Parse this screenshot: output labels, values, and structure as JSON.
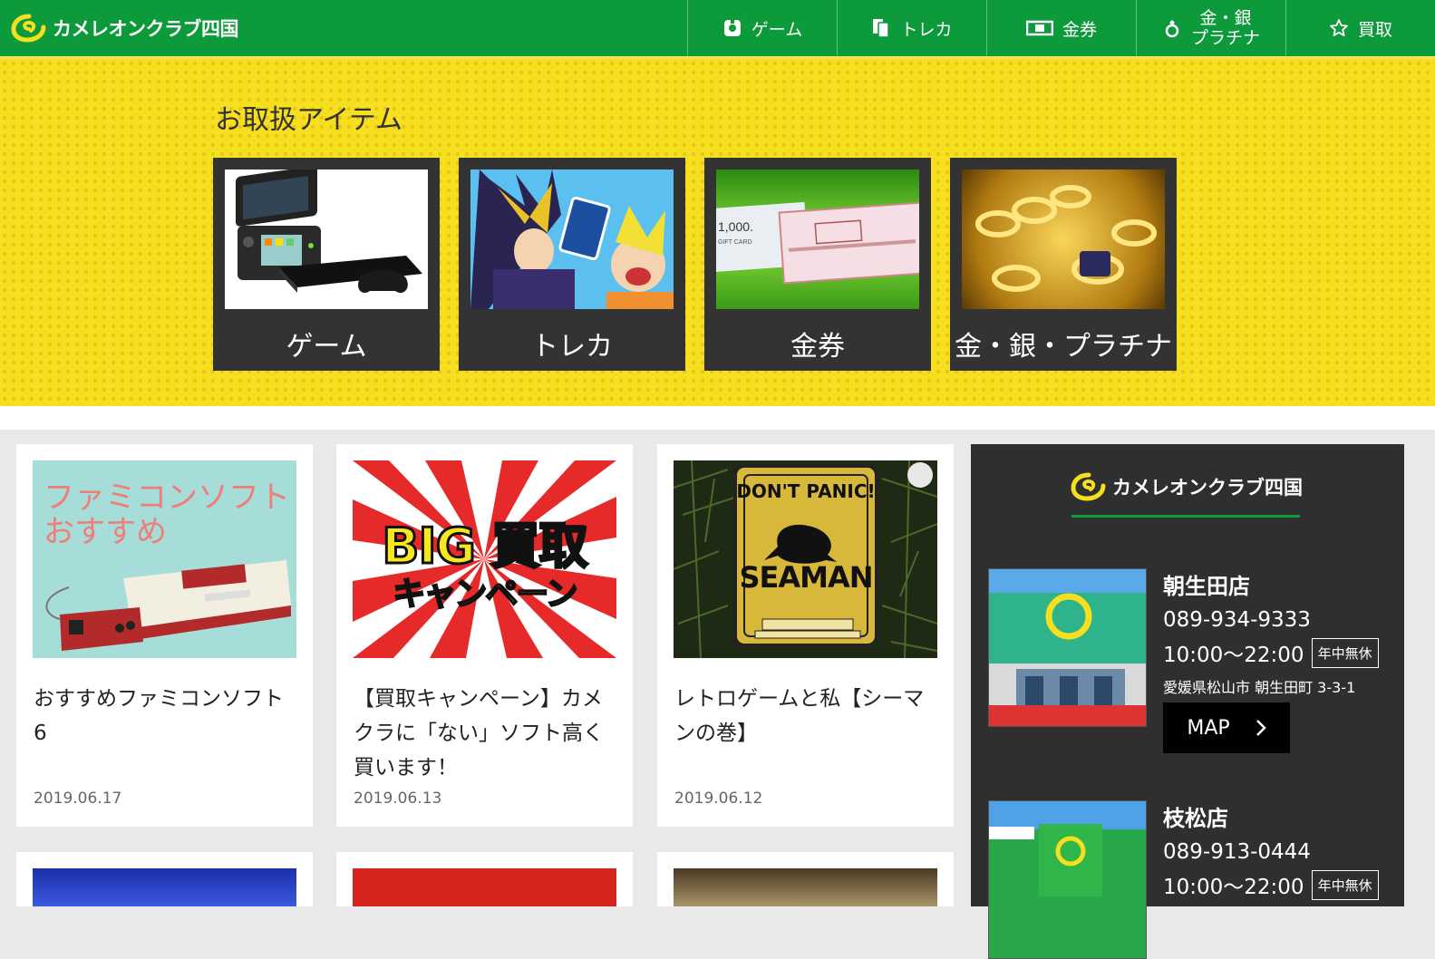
{
  "header": {
    "logo_text": "カメレオンクラブ四国",
    "nav": [
      {
        "label": "ゲーム",
        "icon": "controller-icon"
      },
      {
        "label": "トレカ",
        "icon": "cards-icon"
      },
      {
        "label": "金券",
        "icon": "ticket-icon"
      },
      {
        "label_line1": "金・銀",
        "label_line2": "プラチナ",
        "icon": "ring-icon"
      },
      {
        "label": "買取",
        "icon": "star-icon"
      }
    ]
  },
  "items_section": {
    "heading": "お取扱アイテム",
    "categories": [
      {
        "label": "ゲーム"
      },
      {
        "label": "トレカ"
      },
      {
        "label": "金券"
      },
      {
        "label": "金・銀・プラチナ"
      }
    ]
  },
  "articles": [
    {
      "thumb_text": "ファミコンソフト\nおすすめ",
      "title": "おすすめファミコンソフト6",
      "date": "2019.06.17"
    },
    {
      "thumb_text_1": "BIG 買取",
      "thumb_text_2": "キャンペーン",
      "title": "【買取キャンペーン】カメクラに「ない」ソフト高く買います！",
      "date": "2019.06.13"
    },
    {
      "thumb_text_1": "DON'T PANIC!",
      "thumb_text_2": "SEAMAN",
      "title": "レトロゲームと私【シーマンの巻】",
      "date": "2019.06.12"
    }
  ],
  "sidebar": {
    "logo_text": "カメレオンクラブ四国",
    "shops": [
      {
        "name": "朝生田店",
        "tel": "089-934-9333",
        "hours": "10:00〜22:00",
        "badge": "年中無休",
        "address": "愛媛県松山市 朝生田町 3-3-1",
        "map_label": "MAP"
      },
      {
        "name": "枝松店",
        "tel": "089-913-0444",
        "hours": "10:00〜22:00",
        "badge": "年中無休"
      }
    ]
  },
  "colors": {
    "brand_green": "#0d9a3a",
    "band_yellow": "#f5df1e",
    "dark": "#333333"
  }
}
